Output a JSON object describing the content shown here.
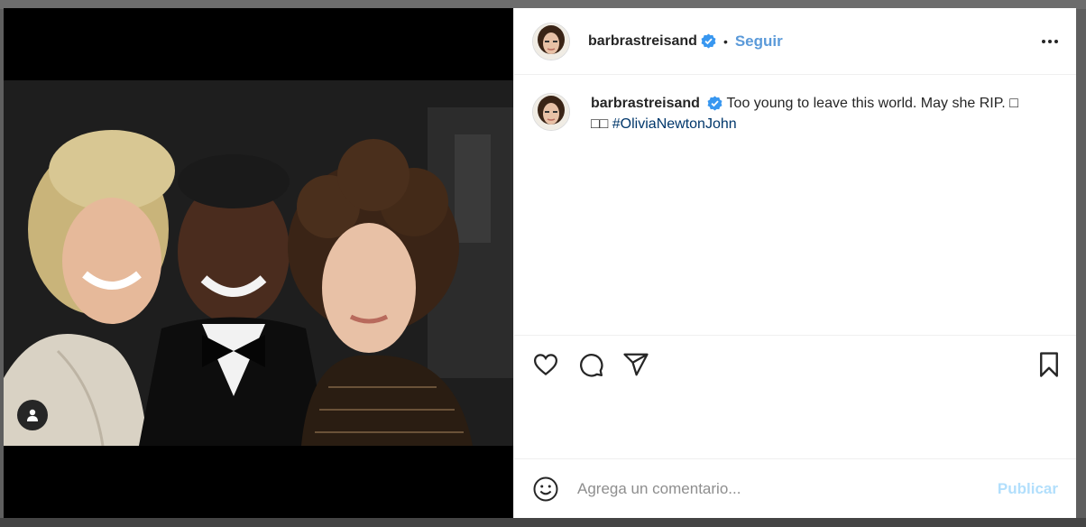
{
  "post": {
    "username": "barbrastreisand",
    "follow_label": "Seguir",
    "separator": "•",
    "caption_text": "Too young to leave this world. May she RIP. □ □□",
    "hashtag": "#OliviaNewtonJohn"
  },
  "comment": {
    "placeholder": "Agrega un comentario...",
    "publish_label": "Publicar"
  },
  "icons": {
    "verified": "verified-badge-icon",
    "more": "more-options-icon",
    "like": "heart-icon",
    "comment": "comment-bubble-icon",
    "share": "paper-plane-icon",
    "save": "bookmark-icon",
    "emoji": "emoji-smiley-icon",
    "tag": "user-tag-icon"
  },
  "colors": {
    "follow": "#5b9ad9",
    "verified": "#3897f0",
    "hashtag": "#00376b",
    "publish_disabled": "#b2dffc",
    "text": "#262626"
  }
}
